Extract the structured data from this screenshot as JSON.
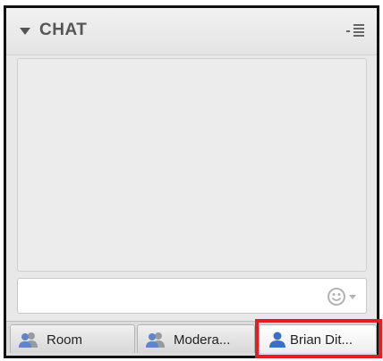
{
  "chat": {
    "title": "CHAT",
    "input": {
      "value": "",
      "placeholder": ""
    },
    "tabs": [
      {
        "label": "Room",
        "icon": "group-users-icon"
      },
      {
        "label": "Modera...",
        "icon": "group-users-icon"
      },
      {
        "label": "Brian Dit...",
        "icon": "user-icon",
        "selected": true
      }
    ]
  },
  "colors": {
    "highlight": "#e01e26",
    "user_icon_blue": "#3a6fc4",
    "group_icon_gray": "#8a8a8a"
  }
}
